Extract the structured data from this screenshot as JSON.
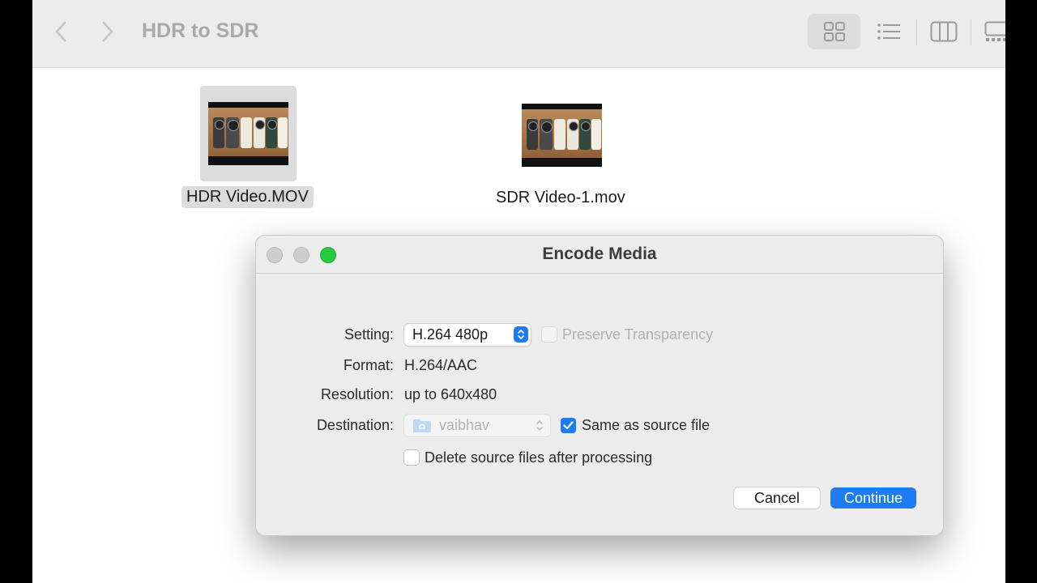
{
  "finder": {
    "title": "HDR to SDR",
    "toolbar_icons": [
      "chevron-left-icon",
      "chevron-right-icon",
      "grid-view-icon",
      "list-view-icon",
      "column-view-icon",
      "gallery-view-icon"
    ],
    "files": [
      {
        "name": "HDR Video.MOV",
        "selected": true
      },
      {
        "name": "SDR Video-1.mov",
        "selected": false
      }
    ]
  },
  "dialog": {
    "title": "Encode Media",
    "traffic_lights": {
      "close": "#cdcdcd",
      "minimize": "#cdcdcd",
      "zoom": "#27c93f"
    },
    "setting_label": "Setting:",
    "setting_value": "H.264 480p",
    "preserve_transparency_label": "Preserve Transparency",
    "preserve_transparency_checked": false,
    "format_label": "Format:",
    "format_value": "H.264/AAC",
    "resolution_label": "Resolution:",
    "resolution_value": "up to 640x480",
    "destination_label": "Destination:",
    "destination_value": "vaibhav",
    "same_as_source_label": "Same as source file",
    "same_as_source_checked": true,
    "delete_source_label": "Delete source files after processing",
    "delete_source_checked": false,
    "cancel_label": "Cancel",
    "continue_label": "Continue"
  },
  "colors": {
    "accent": "#1e7cf2",
    "selection": "#dcdcdc"
  }
}
